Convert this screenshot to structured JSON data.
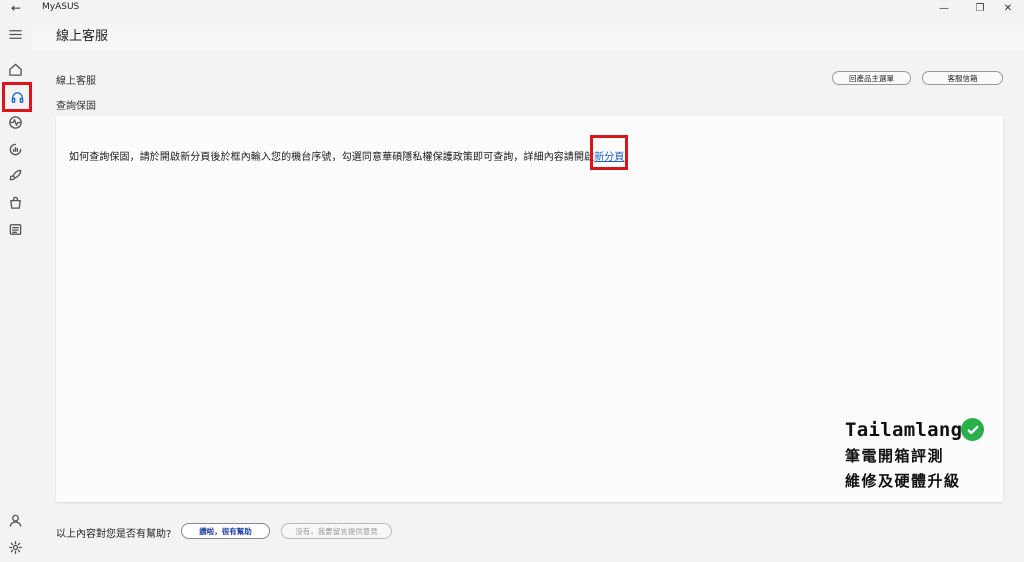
{
  "titlebar": {
    "app_name": "MyASUS",
    "back_glyph": "←",
    "minimize_glyph": "—",
    "maximize_glyph": "❐",
    "close_glyph": "✕"
  },
  "sidebar": {
    "items": [
      {
        "icon": "menu-icon"
      },
      {
        "icon": "home-icon"
      },
      {
        "icon": "headset-icon",
        "active": true
      },
      {
        "icon": "diagnostics-icon"
      },
      {
        "icon": "system-status-icon"
      },
      {
        "icon": "rocket-icon"
      },
      {
        "icon": "shopping-bag-icon"
      },
      {
        "icon": "news-icon"
      },
      {
        "icon": "user-icon"
      },
      {
        "icon": "settings-icon"
      }
    ]
  },
  "header": {
    "title": "線上客服"
  },
  "section": {
    "title": "線上客服",
    "subtitle": "查詢保固",
    "register_button": "回產品主選單",
    "mailbox_button": "客服信箱"
  },
  "card": {
    "text_before": "如何查詢保固，請於開啟新分頁後於框內輸入您的機台序號，勾選同意華碩隱私權保護政策即可查詢，詳細內容請開啟",
    "link_text": "新分頁",
    "text_after": "。"
  },
  "watermark": {
    "brand": "Tailamlang",
    "line1": "筆電開箱評測",
    "line2": "維修及硬體升級"
  },
  "feedback": {
    "question": "以上內容對您是否有幫助?",
    "yes_label": "讚啦，很有幫助",
    "no_label": "沒有，我要留言提供意見"
  },
  "colors": {
    "accent": "#1e67c8",
    "highlight": "#d9161c",
    "check": "#29b04a",
    "link": "#1e5fb8"
  }
}
